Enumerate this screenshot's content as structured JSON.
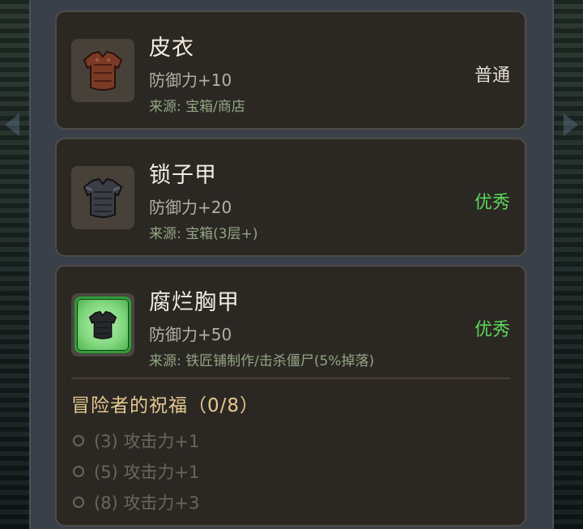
{
  "items": [
    {
      "name": "皮衣",
      "stat": "防御力+10",
      "source": "来源: 宝箱/商店",
      "rarity": "普通",
      "icon": "leather-armor-icon"
    },
    {
      "name": "锁子甲",
      "stat": "防御力+20",
      "source": "来源: 宝箱(3层+)",
      "rarity": "优秀",
      "icon": "chainmail-armor-icon"
    },
    {
      "name": "腐烂胸甲",
      "stat": "防御力+50",
      "source": "来源: 铁匠铺制作/击杀僵尸(5%掉落)",
      "rarity": "优秀",
      "icon": "rotten-chestplate-icon"
    }
  ],
  "blessing": {
    "title": "冒险者的祝福（0/8）",
    "entries": [
      "(3) 攻击力+1",
      "(5) 攻击力+1",
      "(8) 攻击力+3"
    ]
  },
  "colors": {
    "common": "#e3dbd0",
    "good": "#5cd65a",
    "source": "#93a582",
    "bless_title": "#e6c98f",
    "inactive": "#6b655c"
  }
}
